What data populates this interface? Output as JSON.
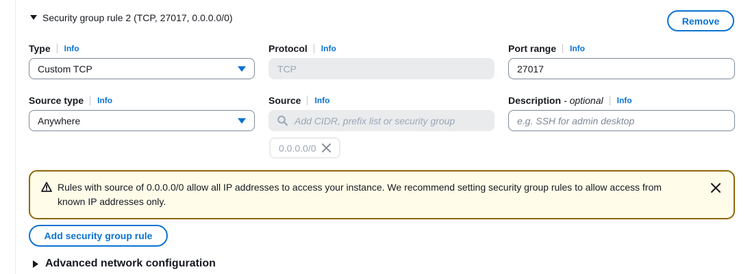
{
  "rule": {
    "header": "Security group rule 2 (TCP, 27017, 0.0.0.0/0)",
    "remove_label": "Remove"
  },
  "fields": {
    "info_label": "Info",
    "type": {
      "label": "Type",
      "value": "Custom TCP"
    },
    "protocol": {
      "label": "Protocol",
      "value": "TCP"
    },
    "port_range": {
      "label": "Port range",
      "value": "27017"
    },
    "source_type": {
      "label": "Source type",
      "value": "Anywhere"
    },
    "source": {
      "label": "Source",
      "placeholder": "Add CIDR, prefix list or security group",
      "token": "0.0.0.0/0"
    },
    "description": {
      "label": "Description",
      "optional": "- optional",
      "placeholder": "e.g. SSH for admin desktop"
    }
  },
  "alert": {
    "text": "Rules with source of 0.0.0.0/0 allow all IP addresses to access your instance. We recommend setting security group rules to allow access from known IP addresses only."
  },
  "add_rule_label": "Add security group rule",
  "advanced_label": "Advanced network configuration",
  "icons": {
    "expand": "caret-down-icon",
    "collapse": "caret-right-icon",
    "select": "dropdown-triangle-icon",
    "search": "search-icon",
    "dismiss": "close-icon",
    "warning": "warning-icon"
  },
  "colors": {
    "accent": "#0972d3",
    "warning_border": "#8d6605",
    "warning_bg": "#fffce9",
    "disabled_bg": "#e9ebed"
  }
}
